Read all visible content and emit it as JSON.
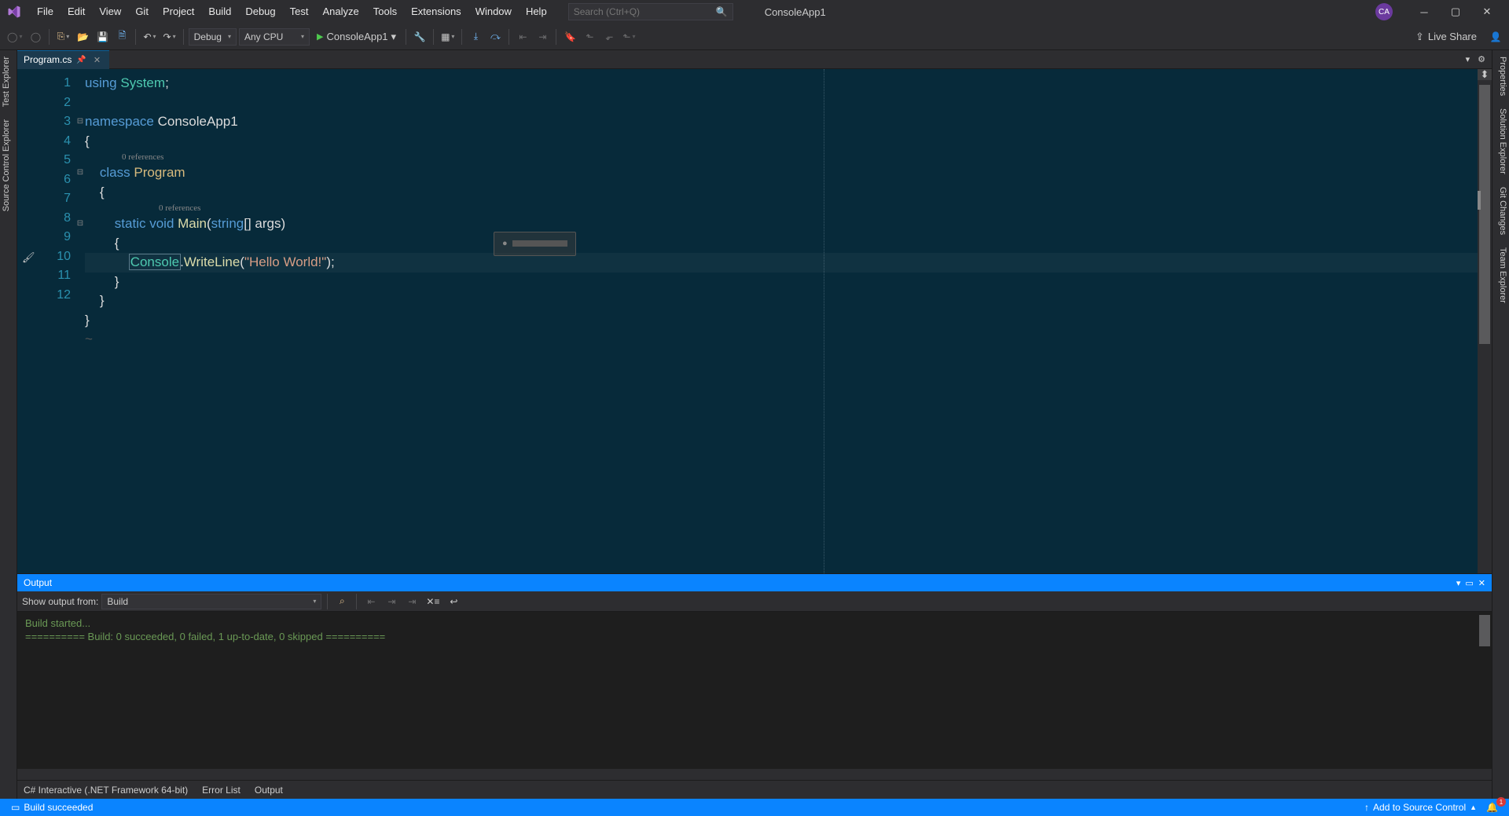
{
  "menu": [
    "File",
    "Edit",
    "View",
    "Git",
    "Project",
    "Build",
    "Debug",
    "Test",
    "Analyze",
    "Tools",
    "Extensions",
    "Window",
    "Help"
  ],
  "search_placeholder": "Search (Ctrl+Q)",
  "app_title": "ConsoleApp1",
  "avatar": "CA",
  "toolbar": {
    "config": "Debug",
    "platform": "Any CPU",
    "run_target": "ConsoleApp1",
    "live_share": "Live Share"
  },
  "left_tabs": [
    "Test Explorer",
    "Source Control Explorer"
  ],
  "right_tabs": [
    "Properties",
    "Solution Explorer",
    "Git Changes",
    "Team Explorer"
  ],
  "doc_tab": "Program.cs",
  "code": {
    "lines": [
      "1",
      "2",
      "3",
      "4",
      "5",
      "6",
      "7",
      "8",
      "9",
      "10",
      "11",
      "12"
    ],
    "ref_text": "0 references",
    "l1_using": "using",
    "l1_sys": "System",
    "l1_semi": ";",
    "l3_ns": "namespace",
    "l3_name": "ConsoleApp1",
    "l4": "{",
    "l5_class": "class",
    "l5_name": "Program",
    "l6": "    {",
    "l7_static": "static",
    "l7_void": "void",
    "l7_main": "Main",
    "l7_open": "(",
    "l7_string": "string",
    "l7_rest": "[] args)",
    "l8": "        {",
    "l9_indent": "            ",
    "l9_console": "Console",
    "l9_dot": ".",
    "l9_write": "WriteLine",
    "l9_open": "(",
    "l9_str": "\"Hello World!\"",
    "l9_close": ");",
    "l10": "        }",
    "l11": "    }",
    "l12": "}",
    "tilde": "~"
  },
  "output": {
    "title": "Output",
    "from_label": "Show output from:",
    "from_value": "Build",
    "lines": [
      "Build started...",
      "========== Build: 0 succeeded, 0 failed, 1 up-to-date, 0 skipped =========="
    ]
  },
  "bottom_tabs": [
    "C# Interactive (.NET Framework 64-bit)",
    "Error List",
    "Output"
  ],
  "status": {
    "build": "Build succeeded",
    "source_ctrl": "Add to Source Control",
    "notif_count": "1"
  }
}
